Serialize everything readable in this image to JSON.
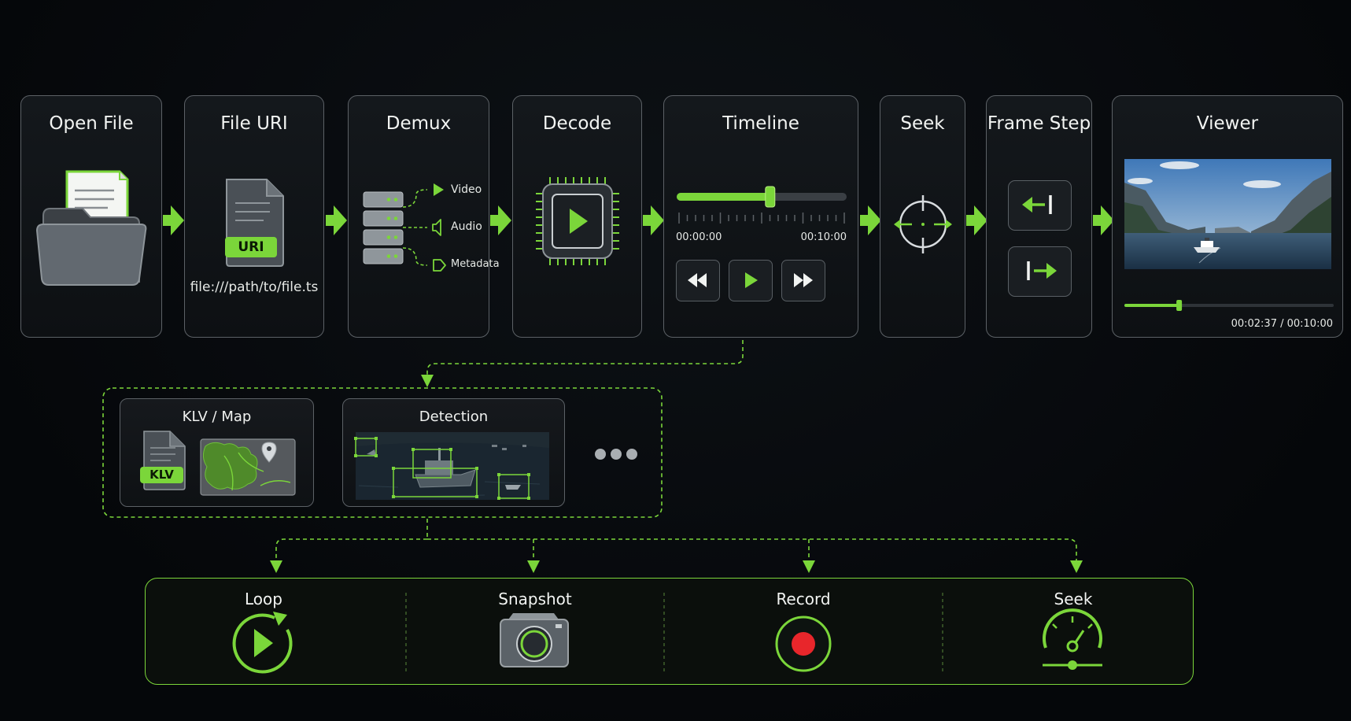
{
  "stages": {
    "open_file": {
      "title": "Open File"
    },
    "file_uri": {
      "title": "File URI",
      "badge": "URI",
      "path": "file:///path/to/file.ts"
    },
    "demux": {
      "title": "Demux",
      "outputs": [
        "Video",
        "Audio",
        "Metadata"
      ]
    },
    "decode": {
      "title": "Decode"
    },
    "timeline": {
      "title": "Timeline",
      "start_time": "00:00:00",
      "end_time": "00:10:00",
      "scrub_progress": 0.55
    },
    "seek": {
      "title": "Seek"
    },
    "frame_step": {
      "title": "Frame Step"
    },
    "viewer": {
      "title": "Viewer",
      "time_readout": "00:02:37 / 00:10:00",
      "progress": 0.2617
    }
  },
  "overlays": {
    "klv_map": {
      "title": "KLV / Map",
      "badge": "KLV"
    },
    "detection": {
      "title": "Detection"
    }
  },
  "actions": {
    "loop": {
      "title": "Loop"
    },
    "snapshot": {
      "title": "Snapshot"
    },
    "record": {
      "title": "Record"
    },
    "seek": {
      "title": "Seek"
    }
  },
  "colors": {
    "accent": "#7bd63a",
    "border": "#5c6166",
    "background": "#06080a",
    "record": "#e8262b"
  },
  "icons": [
    "folder-icon",
    "document-icon",
    "server-stack-icon",
    "chip-icon",
    "crosshair-icon",
    "step-back-icon",
    "step-forward-icon",
    "rewind-icon",
    "play-icon",
    "fast-forward-icon",
    "map-pin-icon",
    "loop-play-icon",
    "camera-icon",
    "record-icon",
    "gauge-icon"
  ]
}
